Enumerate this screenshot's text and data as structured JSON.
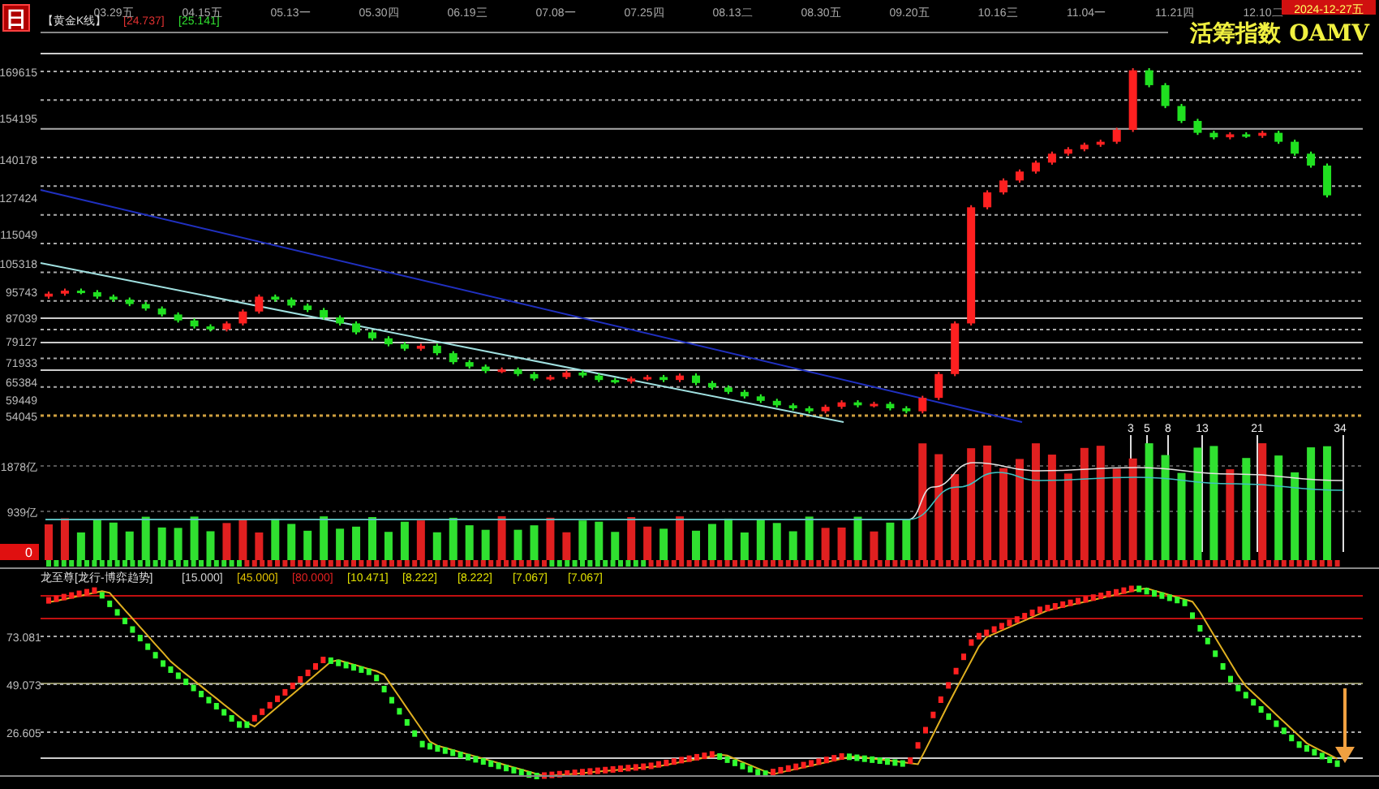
{
  "header": {
    "logo": "日",
    "title": "【黄金K线】",
    "values": [
      {
        "text": "[24.737]",
        "color": "#e03030"
      },
      {
        "text": "[25.141]",
        "color": "#30e030"
      }
    ],
    "dates": [
      "03.29五",
      "04.15五",
      "05.13一",
      "05.30四",
      "06.19三",
      "07.08一",
      "07.25四",
      "08.13二",
      "08.30五",
      "09.20五",
      "10.16三",
      "11.04一",
      "11.21四",
      "12.10二"
    ],
    "brand": "活筹指数 OAMV",
    "date_badge": "2024-12-27五"
  },
  "price_grid_lines": [
    {
      "kind": "dashed"
    },
    {
      "kind": "dashed"
    },
    {
      "kind": "solid"
    },
    {
      "kind": "dashed"
    },
    {
      "kind": "dashed"
    },
    {
      "kind": "dashed"
    },
    {
      "kind": "dashed"
    },
    {
      "kind": "dashed"
    },
    {
      "kind": "dashed"
    },
    {
      "kind": "dashed"
    },
    {
      "kind": "dashed"
    },
    {
      "kind": "dashed"
    },
    {
      "kind": "orange"
    }
  ],
  "price_chart": {
    "chart_data": {
      "type": "candlestick",
      "ylim": [
        54045,
        169615
      ],
      "yticks": [
        {
          "value": 169615,
          "label": "169615"
        },
        {
          "value": 154195,
          "label": "154195"
        },
        {
          "value": 140178,
          "label": "140178"
        },
        {
          "value": 127424,
          "label": "127424"
        },
        {
          "value": 115049,
          "label": "115049"
        },
        {
          "value": 105318,
          "label": "105318"
        },
        {
          "value": 95743,
          "label": "95743"
        },
        {
          "value": 87039,
          "label": "87039"
        },
        {
          "value": 79127,
          "label": "79127"
        },
        {
          "value": 71933,
          "label": "71933"
        },
        {
          "value": 65384,
          "label": "65384"
        },
        {
          "value": 59449,
          "label": "59449"
        },
        {
          "value": 54045,
          "label": "54045"
        }
      ],
      "categories": [
        null,
        null,
        null,
        null,
        null,
        null,
        null,
        null,
        null,
        null,
        null,
        null,
        null,
        null,
        null,
        null,
        null,
        null,
        null,
        null,
        null,
        null,
        null,
        null,
        null,
        null,
        null,
        null,
        null,
        null,
        null,
        null,
        null,
        null,
        null,
        null,
        null,
        null,
        null,
        null,
        null,
        null,
        null,
        null,
        null,
        null,
        null,
        null,
        null,
        null,
        null,
        null,
        null,
        null,
        null,
        null,
        null,
        null,
        null,
        null,
        null,
        null,
        null,
        null,
        null,
        null,
        null,
        null,
        null,
        null,
        null,
        null,
        null,
        null,
        null,
        null,
        null,
        null,
        null,
        null
      ],
      "ohlc": [
        [
          94000,
          95700,
          93300,
          95000
        ],
        [
          95000,
          96700,
          94300,
          96000
        ],
        [
          96000,
          96700,
          94800,
          95500
        ],
        [
          95500,
          96200,
          93300,
          94000
        ],
        [
          94000,
          94700,
          92300,
          93000
        ],
        [
          93000,
          93700,
          90800,
          91500
        ],
        [
          91500,
          92200,
          89300,
          90000
        ],
        [
          90000,
          90700,
          87300,
          88000
        ],
        [
          88000,
          88700,
          85300,
          86000
        ],
        [
          86000,
          86700,
          83300,
          84000
        ],
        [
          84000,
          84700,
          82300,
          83000
        ],
        [
          83000,
          85700,
          82300,
          85000
        ],
        [
          85000,
          89700,
          84300,
          89000
        ],
        [
          89000,
          94700,
          88300,
          94000
        ],
        [
          94000,
          94700,
          92300,
          93000
        ],
        [
          93000,
          93700,
          90300,
          91000
        ],
        [
          91000,
          91700,
          88800,
          89500
        ],
        [
          89500,
          90200,
          86300,
          87000
        ],
        [
          87000,
          87700,
          84300,
          85000
        ],
        [
          85000,
          85700,
          81300,
          82000
        ],
        [
          82000,
          82700,
          79300,
          80000
        ],
        [
          80000,
          80700,
          77300,
          78000
        ],
        [
          78000,
          78700,
          75800,
          76500
        ],
        [
          76500,
          78200,
          75800,
          77500
        ],
        [
          77500,
          78200,
          74300,
          75000
        ],
        [
          75000,
          75700,
          71300,
          72000
        ],
        [
          72000,
          72700,
          69800,
          70500
        ],
        [
          70500,
          71200,
          68300,
          69000
        ],
        [
          69000,
          70200,
          68300,
          69500
        ],
        [
          69500,
          70200,
          67300,
          68000
        ],
        [
          68000,
          68700,
          65800,
          66500
        ],
        [
          66500,
          67700,
          65800,
          67000
        ],
        [
          67000,
          69200,
          66300,
          68500
        ],
        [
          68500,
          69200,
          66800,
          67500
        ],
        [
          67500,
          68200,
          65300,
          66000
        ],
        [
          66000,
          66700,
          64800,
          65500
        ],
        [
          65500,
          67200,
          64800,
          66500
        ],
        [
          66500,
          67700,
          65800,
          67000
        ],
        [
          67000,
          67700,
          65300,
          66000
        ],
        [
          66000,
          68200,
          65300,
          67500
        ],
        [
          67500,
          68200,
          64300,
          65000
        ],
        [
          65000,
          65700,
          62800,
          63500
        ],
        [
          63500,
          64200,
          61300,
          62000
        ],
        [
          62000,
          62700,
          59800,
          60500
        ],
        [
          60500,
          61200,
          58300,
          59000
        ],
        [
          59000,
          59700,
          56800,
          57500
        ],
        [
          57500,
          58200,
          55800,
          56500
        ],
        [
          56500,
          57200,
          54800,
          55500
        ],
        [
          55500,
          57700,
          54800,
          57000
        ],
        [
          57000,
          59200,
          56300,
          58500
        ],
        [
          58500,
          59200,
          56800,
          57500
        ],
        [
          57500,
          58700,
          56800,
          58000
        ],
        [
          58000,
          58700,
          55800,
          56500
        ],
        [
          56500,
          57200,
          54800,
          55500
        ],
        [
          55500,
          60700,
          54800,
          60000
        ],
        [
          60000,
          68700,
          59300,
          68000
        ],
        [
          68000,
          85700,
          67300,
          85000
        ],
        [
          85000,
          124700,
          84300,
          124000
        ],
        [
          124000,
          129700,
          123300,
          129000
        ],
        [
          129000,
          133700,
          128300,
          133000
        ],
        [
          133000,
          136700,
          132300,
          136000
        ],
        [
          136000,
          139700,
          135300,
          139000
        ],
        [
          139000,
          142700,
          138300,
          142000
        ],
        [
          142000,
          144200,
          141300,
          143500
        ],
        [
          143500,
          145700,
          142800,
          145000
        ],
        [
          145000,
          146700,
          144300,
          146000
        ],
        [
          146000,
          150700,
          145300,
          150000
        ],
        [
          150000,
          170700,
          149300,
          170000
        ],
        [
          170000,
          170700,
          164300,
          165000
        ],
        [
          165000,
          165700,
          157300,
          158000
        ],
        [
          158000,
          158700,
          152300,
          153000
        ],
        [
          153000,
          153700,
          148300,
          149000
        ],
        [
          149000,
          149700,
          146800,
          147500
        ],
        [
          147500,
          149200,
          146800,
          148500
        ],
        [
          148500,
          149200,
          147300,
          148000
        ],
        [
          148000,
          149700,
          147300,
          149000
        ],
        [
          149000,
          149700,
          145300,
          146000
        ],
        [
          146000,
          146700,
          141300,
          142000
        ],
        [
          142000,
          142700,
          137300,
          138000
        ],
        [
          138000,
          138700,
          127300,
          128000
        ]
      ]
    }
  },
  "volume_axis": [
    "1878亿",
    "939亿"
  ],
  "volume_zero": "0",
  "volume_markers": [
    "3",
    "5",
    "8",
    "13",
    "21",
    "34"
  ],
  "indicator": {
    "name": "龙至尊[龙行-博弈趋势]",
    "params": [
      {
        "text": "[15.000]",
        "color": "#d0d0d0"
      },
      {
        "text": "[45.000]",
        "color": "#e0c000"
      },
      {
        "text": "[80.000]",
        "color": "#e02020"
      },
      {
        "text": "[10.471]",
        "color": "#e0e000"
      },
      {
        "text": "[8.222]",
        "color": "#e0e000"
      },
      {
        "text": "[8.222]",
        "color": "#e0e000"
      },
      {
        "text": "[7.067]",
        "color": "#e0e000"
      },
      {
        "text": "[7.067]",
        "color": "#e0e000"
      }
    ],
    "axis": [
      "73.081",
      "49.073",
      "26.605"
    ]
  }
}
